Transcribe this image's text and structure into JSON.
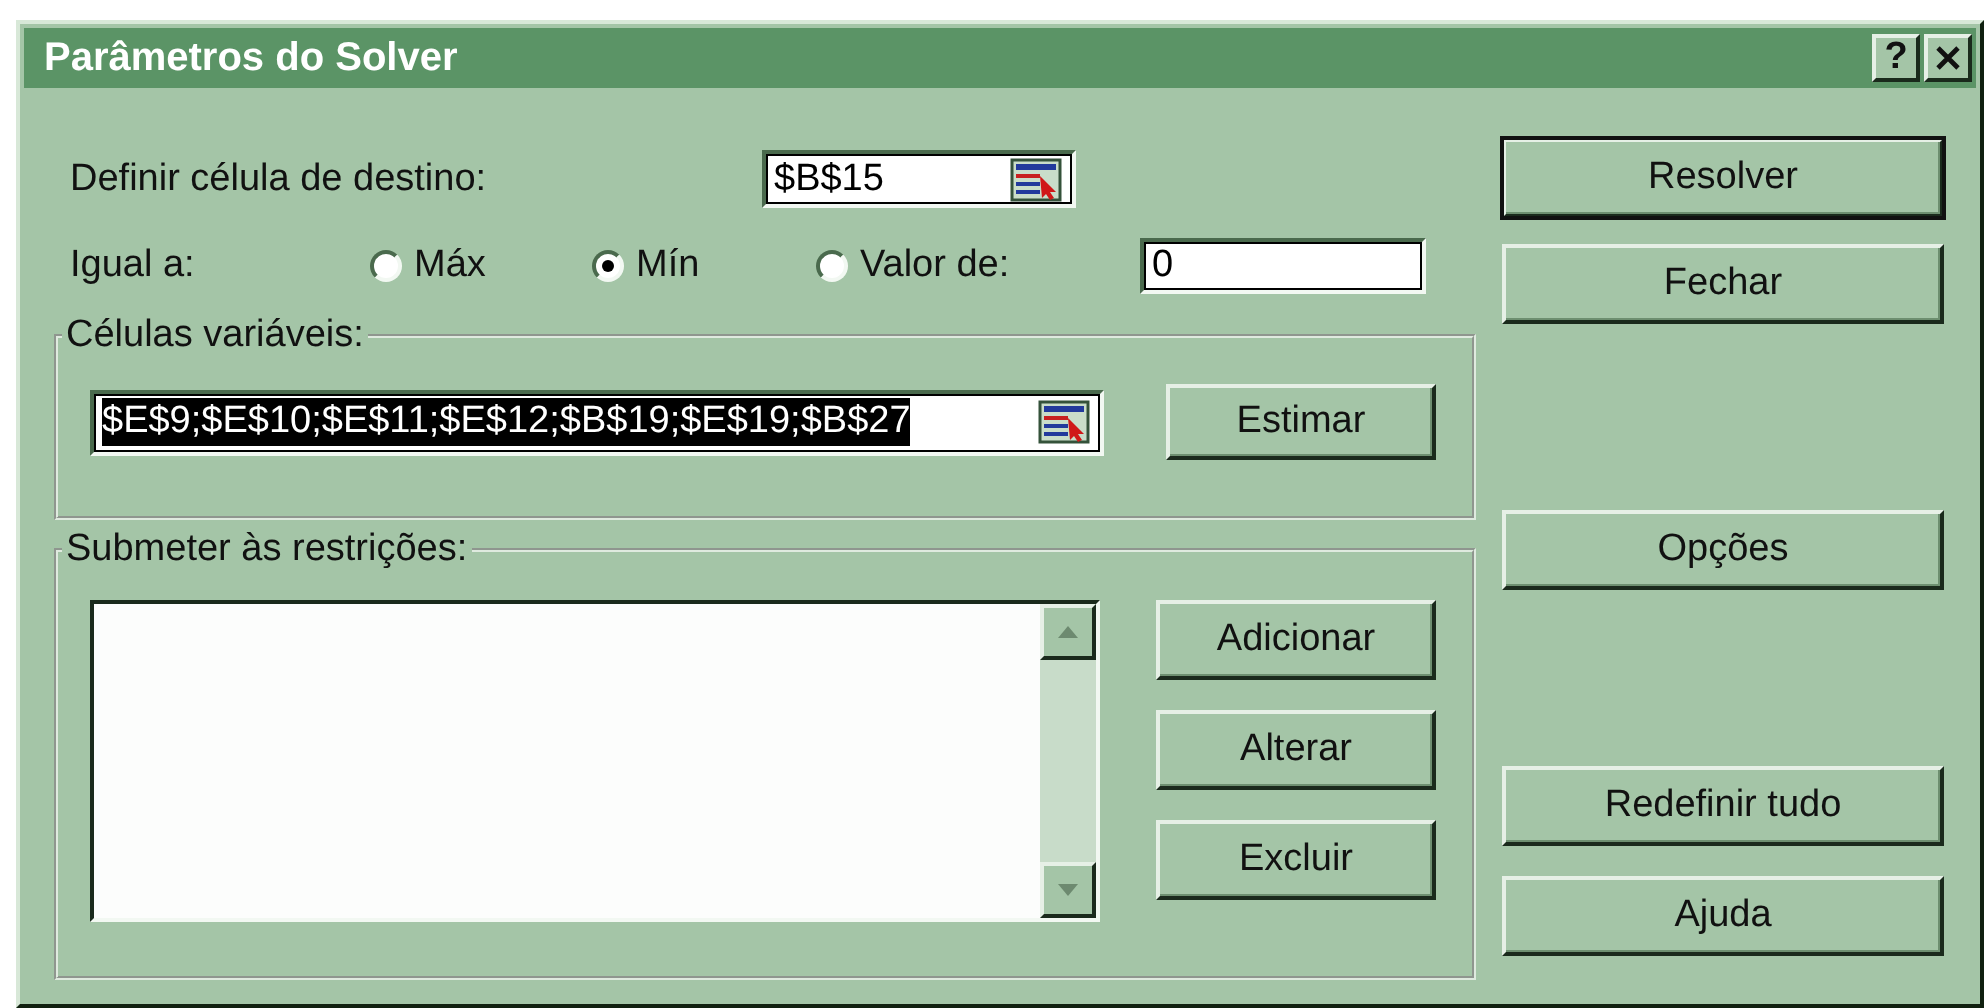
{
  "window": {
    "title": "Parâmetros do Solver",
    "help": "?"
  },
  "target": {
    "label": "Definir célula de destino:",
    "value": "$B$15"
  },
  "equal_to": {
    "label": "Igual a:",
    "options": [
      {
        "label": "Máx",
        "selected": false
      },
      {
        "label": "Mín",
        "selected": true
      },
      {
        "label": "Valor de:",
        "selected": false
      }
    ],
    "value": "0"
  },
  "variable_cells": {
    "label": "Células variáveis:",
    "value": "$E$9;$E$10;$E$11;$E$12;$B$19;$E$19;$B$27",
    "selected": true,
    "button": "Estimar"
  },
  "constraints": {
    "label": "Submeter às restrições:",
    "buttons": [
      "Adicionar",
      "Alterar",
      "Excluir"
    ]
  },
  "side_buttons": [
    {
      "label": "Resolver",
      "default": true
    },
    {
      "label": "Fechar",
      "default": false
    },
    {
      "label": "Opções",
      "default": false
    },
    {
      "label": "Redefinir tudo",
      "default": false
    },
    {
      "label": "Ajuda",
      "default": false
    }
  ]
}
